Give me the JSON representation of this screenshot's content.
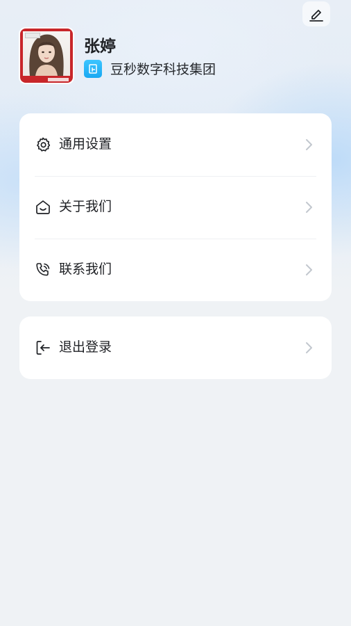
{
  "user": {
    "name": "张婷",
    "company": "豆秒数字科技集团"
  },
  "menu_main": [
    {
      "label": "通用设置",
      "icon": "gear-icon"
    },
    {
      "label": "关于我们",
      "icon": "home-smile-icon"
    },
    {
      "label": "联系我们",
      "icon": "phone-call-icon"
    }
  ],
  "menu_logout": {
    "label": "退出登录",
    "icon": "logout-icon"
  },
  "colors": {
    "accent_blue": "#19a8f2",
    "text_primary": "#1f2125",
    "chevron": "#c2c7ce",
    "avatar_frame": "#c8262a",
    "page_bg": "#eff2f5"
  }
}
